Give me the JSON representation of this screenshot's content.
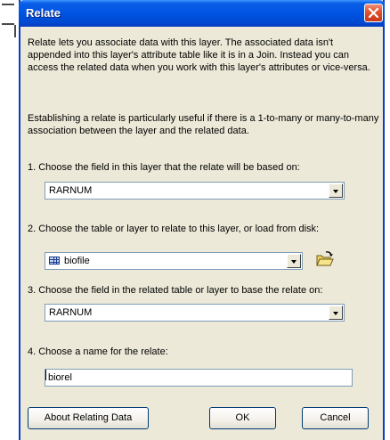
{
  "window": {
    "title": "Relate"
  },
  "intro": {
    "para1": "Relate lets you associate data with this layer. The associated data isn't appended into this layer's attribute table like it is in a Join. Instead you can access the related data when you work with this layer's attributes or vice-versa.",
    "para2": "Establishing a relate is particularly useful if there is a 1-to-many or many-to-many association between the layer and the related data."
  },
  "step1": {
    "label": "1. Choose the field in this layer that the relate will be based on:",
    "value": "RARNUM"
  },
  "step2": {
    "label": "2. Choose the table or layer to relate to this layer, or load from disk:",
    "value": "biofile"
  },
  "step3": {
    "label": "3. Choose the field in the related table or layer to base the relate on:",
    "value": "RARNUM"
  },
  "step4": {
    "label": "4. Choose a name for the relate:",
    "value": "biorel"
  },
  "buttons": {
    "about": "About Relating Data",
    "ok": "OK",
    "cancel": "Cancel"
  },
  "icons": {
    "close": "close-icon",
    "table": "table-icon",
    "folder": "open-folder-icon",
    "dropdown": "chevron-down-icon"
  },
  "colors": {
    "titlebar": "#0054e3",
    "dialog_bg": "#ece9d8",
    "close_btn": "#e0502c",
    "field_border": "#7f9db9"
  }
}
